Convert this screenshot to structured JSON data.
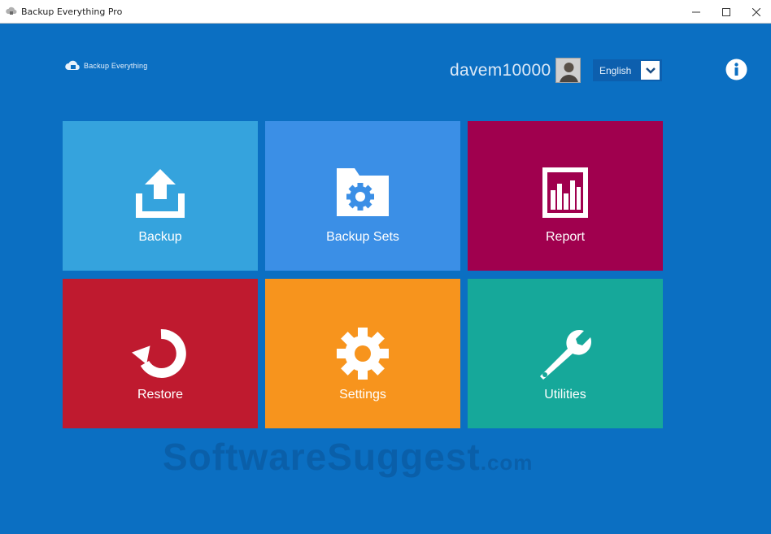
{
  "window": {
    "title": "Backup Everything Pro",
    "controls": [
      "minimize",
      "maximize",
      "close"
    ]
  },
  "header": {
    "logo_text": "Backup Everything",
    "username": "davem10000",
    "language": "English",
    "info_icon": "info-icon"
  },
  "tiles": [
    {
      "label": "Backup",
      "icon": "upload-icon",
      "color": "#35a3dd"
    },
    {
      "label": "Backup Sets",
      "icon": "folder-gear-icon",
      "color": "#3b8fe6"
    },
    {
      "label": "Report",
      "icon": "report-chart-icon",
      "color": "#a0004e"
    },
    {
      "label": "Restore",
      "icon": "restore-icon",
      "color": "#bf1a2f"
    },
    {
      "label": "Settings",
      "icon": "gear-icon",
      "color": "#f7941d"
    },
    {
      "label": "Utilities",
      "icon": "wrench-icon",
      "color": "#16a89a"
    }
  ],
  "watermark": {
    "text": "SoftwareSuggest",
    "suffix": ".com"
  },
  "colors": {
    "background": "#0b6fc2",
    "titlebar": "#ffffff"
  }
}
